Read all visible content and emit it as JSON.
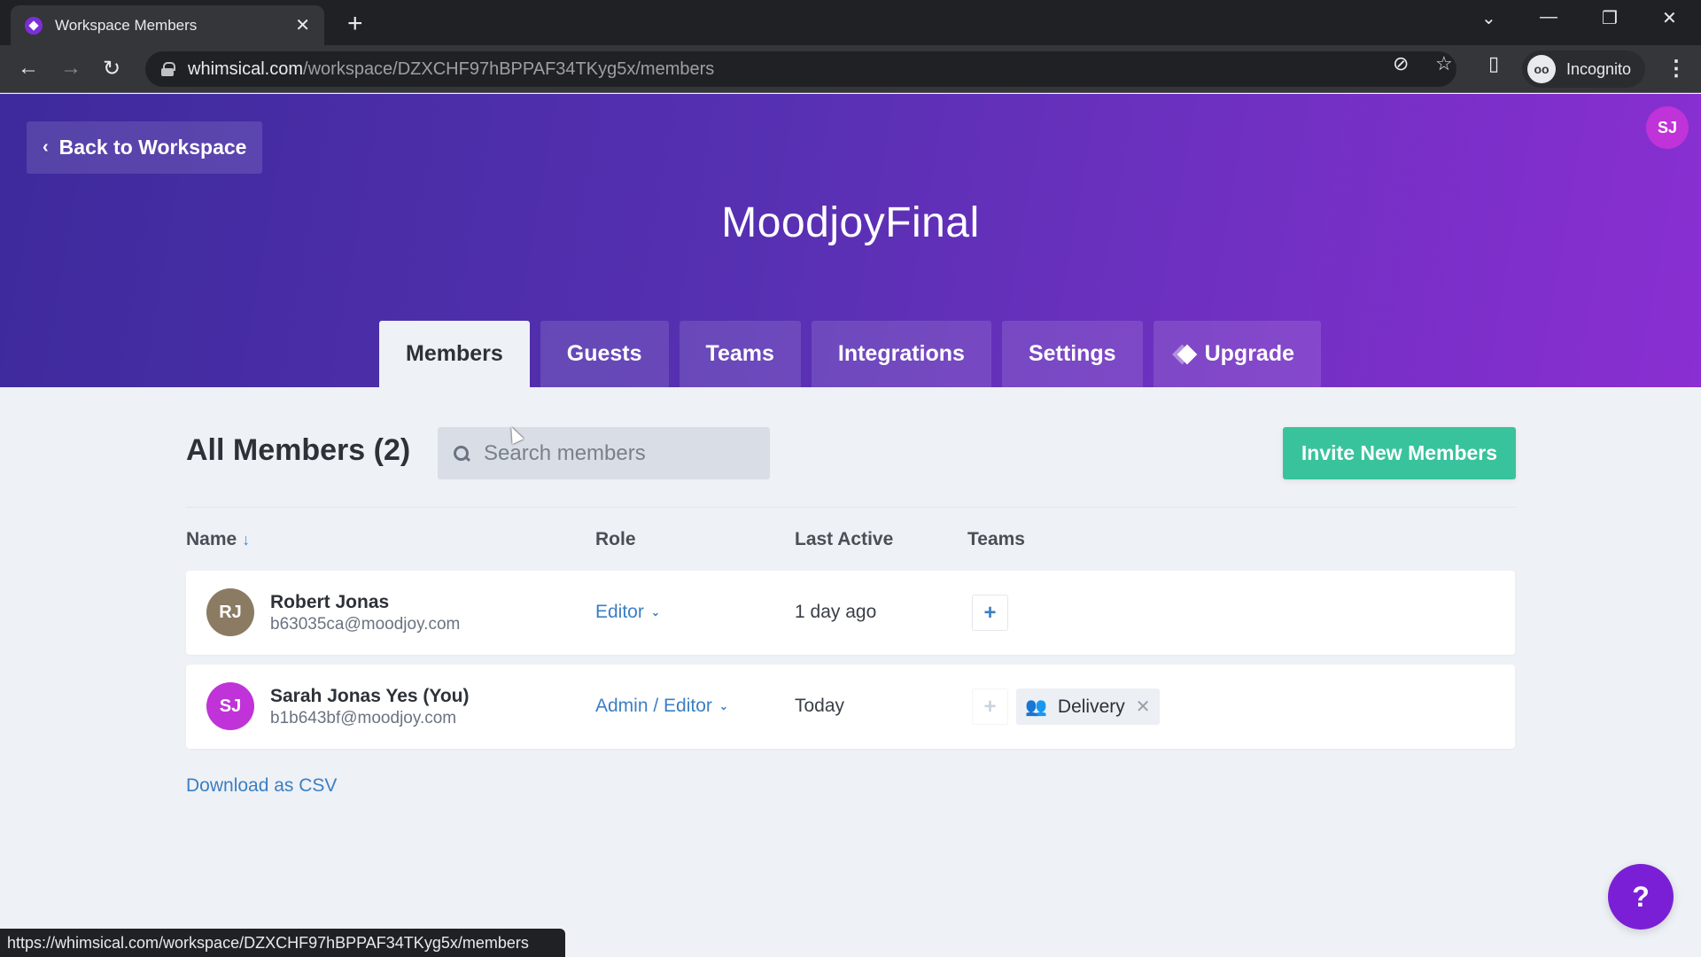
{
  "browser": {
    "tab_title": "Workspace Members",
    "url_host": "whimsical.com",
    "url_path": "/workspace/DZXCHF97hBPPAF34TKyg5x/members",
    "profile_label": "Incognito",
    "status_url": "https://whimsical.com/workspace/DZXCHF97hBPPAF34TKyg5x/members"
  },
  "header": {
    "back_label": "Back to Workspace",
    "workspace_title": "MoodjoyFinal",
    "user_initials": "SJ",
    "tabs": [
      {
        "label": "Members",
        "active": true
      },
      {
        "label": "Guests",
        "active": false
      },
      {
        "label": "Teams",
        "active": false
      },
      {
        "label": "Integrations",
        "active": false
      },
      {
        "label": "Settings",
        "active": false
      },
      {
        "label": "Upgrade",
        "active": false,
        "icon": "diamond-icon"
      }
    ]
  },
  "members": {
    "title": "All Members (2)",
    "search_placeholder": "Search members",
    "invite_label": "Invite New Members",
    "columns": {
      "name": "Name",
      "role": "Role",
      "last_active": "Last Active",
      "teams": "Teams"
    },
    "sort_icon": "↓",
    "rows": [
      {
        "initials": "RJ",
        "avatar_color": "#8b7b63",
        "name": "Robert Jonas",
        "email": "b63035ca@moodjoy.com",
        "role": "Editor",
        "last_active": "1 day ago",
        "teams": []
      },
      {
        "initials": "SJ",
        "avatar_color": "#c033d8",
        "name": "Sarah Jonas Yes (You)",
        "email": "b1b643bf@moodjoy.com",
        "role": "Admin / Editor",
        "last_active": "Today",
        "teams": [
          {
            "name": "Delivery",
            "icon": "team-group-icon",
            "color": "#b0435a"
          }
        ]
      }
    ],
    "download_label": "Download as CSV"
  },
  "colors": {
    "accent_green": "#38c39c",
    "link_blue": "#3b7fc4",
    "help_purple": "#7b1fd6"
  }
}
